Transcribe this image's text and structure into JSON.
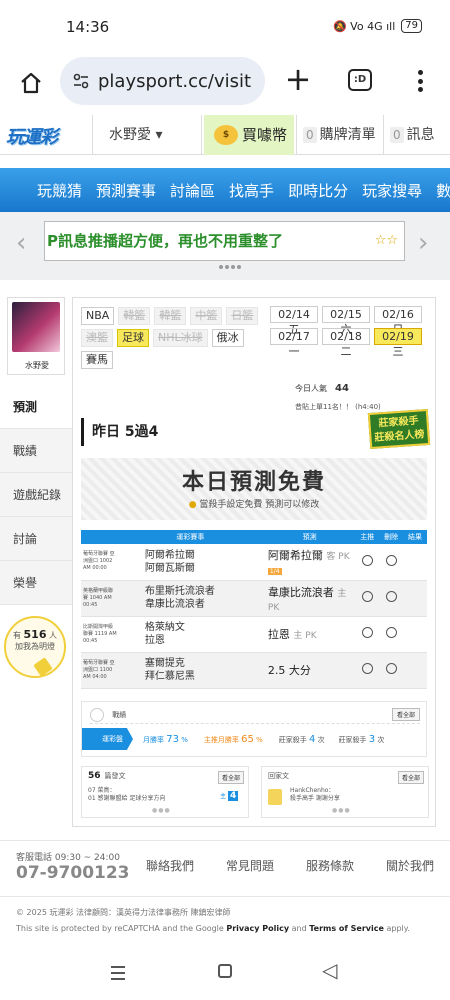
{
  "statusbar": {
    "time": "14:36",
    "icons": "🔕 Vo 4G ıll",
    "battery": "79"
  },
  "browser": {
    "url": "playsport.cc/visit",
    "tabs_count": ":D"
  },
  "header": {
    "logo": "玩運彩",
    "user": "水野愛",
    "buy_coin": "買噱幣",
    "cart_label": "購牌清單",
    "cart_count": "0",
    "msg_label": "訊息",
    "msg_count": "0"
  },
  "nav": [
    "玩競猜",
    "預測賽事",
    "討論區",
    "找高手",
    "即時比分",
    "玩家搜尋",
    "數據"
  ],
  "marquee": {
    "text": "P訊息推播超方便，再也不用重整了",
    "stars": "☆☆"
  },
  "sidebar": {
    "username": "水野愛",
    "tabs": [
      "預測",
      "戰績",
      "遊戲紀錄",
      "討論",
      "榮譽"
    ],
    "fans_prefix": "有",
    "fans_count": "516",
    "fans_unit": "人",
    "fans_text": "加我為明燈"
  },
  "leagues": [
    {
      "label": "NBA",
      "state": "normal"
    },
    {
      "label": "韓籃",
      "state": "disabled"
    },
    {
      "label": "韓籃",
      "state": "disabled"
    },
    {
      "label": "中籃",
      "state": "disabled"
    },
    {
      "label": "日籃",
      "state": "disabled"
    },
    {
      "label": "澳籃",
      "state": "disabled"
    },
    {
      "label": "足球",
      "state": "selected"
    },
    {
      "label": "NHL冰球",
      "state": "disabled"
    },
    {
      "label": "俄冰",
      "state": "normal"
    },
    {
      "label": "賽馬",
      "state": "normal"
    }
  ],
  "dates": [
    {
      "label": "02/14 五",
      "selected": false
    },
    {
      "label": "02/15 六",
      "selected": false
    },
    {
      "label": "02/16 日",
      "selected": false
    },
    {
      "label": "02/17 一",
      "selected": false
    },
    {
      "label": "02/18 二",
      "selected": false
    },
    {
      "label": "02/19 三",
      "selected": true
    }
  ],
  "views": {
    "today_label": "今日人氣",
    "today_count": "44",
    "max_label": "昔貼上單11名！！ (h4:40)"
  },
  "badge": "莊家殺手\n莊殺名人榜",
  "yesterday": "昨日 5過4",
  "banner": {
    "title": "本日預測免費",
    "sub": "當殺手設定免費 預測可以修改"
  },
  "table": {
    "headers": [
      "",
      "運彩賽事",
      "預測",
      "主推",
      "刪除",
      "結果"
    ],
    "rows": [
      {
        "league": "葡萄牙聯賽 亞洲盤口 1002 AM 00:00",
        "home": "阿爾希拉爾",
        "away": "阿爾瓦斯爾",
        "pick": "阿爾希拉爾",
        "pick_tag": "客 PK",
        "extra": "1/4"
      },
      {
        "league": "英格蘭甲級聯賽 1040 AM 00:45",
        "home": "布里斯托流浪者",
        "away": "韋康比流浪者",
        "pick": "韋康比流浪者",
        "pick_tag": "主 PK",
        "extra": ""
      },
      {
        "league": "比斯開灣甲級 聯賽 1119 AM 00:45",
        "home": "格萊納文",
        "away": "拉恩",
        "pick": "拉恩",
        "pick_tag": "主 PK",
        "extra": ""
      },
      {
        "league": "葡萄牙聯賽 亞洲盤口 1100 AM 04:00",
        "home": "塞爾提克",
        "away": "拜仁慕尼黑",
        "pick": "2.5 大分",
        "pick_tag": "",
        "extra": ""
      }
    ]
  },
  "wins": {
    "title": "戰績",
    "more": "看全部",
    "tab": "運彩盤",
    "stats": [
      {
        "label": "月勝率",
        "value": "73",
        "unit": "%",
        "color": "blue"
      },
      {
        "label": "主推月勝率",
        "value": "65",
        "unit": "%",
        "color": "orange"
      },
      {
        "label": "莊家殺手",
        "value": "4",
        "unit": "次",
        "color": "blue"
      },
      {
        "label": "莊家殺手",
        "value": "3",
        "unit": "次",
        "color": "blue"
      }
    ]
  },
  "box_a": {
    "count": "56",
    "title": "篇發文",
    "more": "看全部",
    "line1": "07 菜鳥：",
    "line2": "01 感謝聯盟給 足球分享方向",
    "num_label": "主",
    "num": "4"
  },
  "box_b": {
    "title": "回家文",
    "more": "看全部",
    "name": "HankChenho：",
    "text": "殺手高手 謝謝分享"
  },
  "footer": {
    "hours": "客服電話 09:30 ~ 24:00",
    "phone": "07-9700123",
    "links": [
      "聯絡我們",
      "常見問題",
      "服務條款",
      "關於我們"
    ],
    "copyright": "© 2025 玩運彩 法律顧問：漢英得力法律事務所 陳鎮宏律師",
    "recaptcha_pre": "This site is protected by reCAPTCHA and the Google",
    "privacy": "Privacy Policy",
    "and": "and",
    "terms": "Terms of Service",
    "apply": "apply."
  }
}
